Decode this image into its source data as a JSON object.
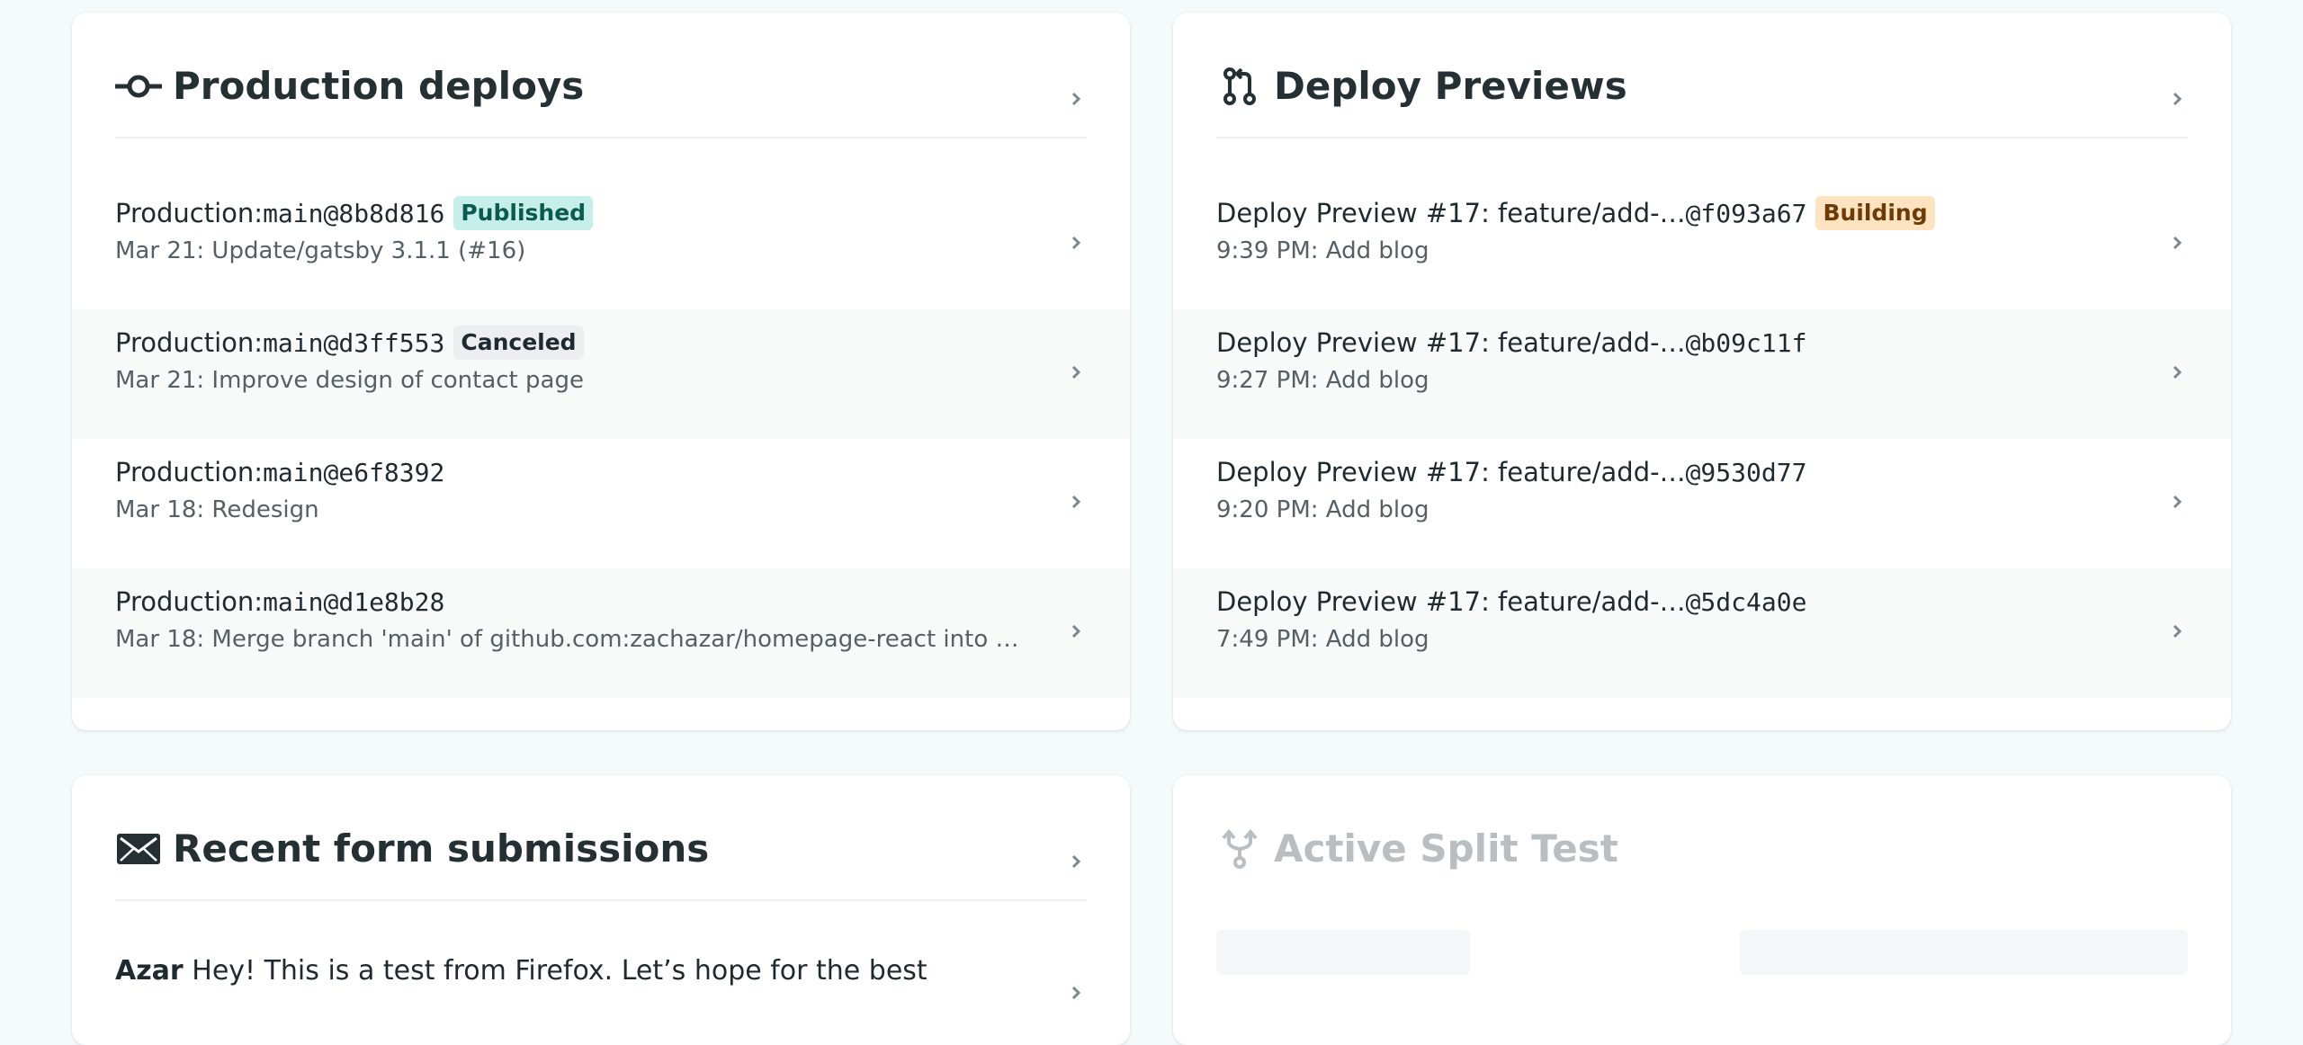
{
  "production": {
    "title": "Production deploys",
    "rows": [
      {
        "label": "Production: ",
        "ref": "main@8b8d816",
        "badge": "Published",
        "badge_type": "published",
        "sub": "Mar 21: Update/gatsby 3.1.1 (#16)"
      },
      {
        "label": "Production: ",
        "ref": "main@d3ff553",
        "badge": "Canceled",
        "badge_type": "canceled",
        "sub": "Mar 21: Improve design of contact page"
      },
      {
        "label": "Production: ",
        "ref": "main@e6f8392",
        "badge": "",
        "badge_type": "",
        "sub": "Mar 18: Redesign"
      },
      {
        "label": "Production: ",
        "ref": "main@d1e8b28",
        "badge": "",
        "badge_type": "",
        "sub": "Mar 18: Merge branch 'main' of github.com:zachazar/homepage-react into main"
      }
    ]
  },
  "previews": {
    "title": "Deploy Previews",
    "rows": [
      {
        "label": "Deploy Preview #17: feature/add-…",
        "ref": "@f093a67",
        "badge": "Building",
        "badge_type": "building",
        "sub": "9:39 PM: Add blog"
      },
      {
        "label": "Deploy Preview #17: feature/add-…",
        "ref": "@b09c11f",
        "badge": "",
        "badge_type": "",
        "sub": "9:27 PM: Add blog"
      },
      {
        "label": "Deploy Preview #17: feature/add-…",
        "ref": "@9530d77",
        "badge": "",
        "badge_type": "",
        "sub": "9:20 PM: Add blog"
      },
      {
        "label": "Deploy Preview #17: feature/add-…",
        "ref": "@5dc4a0e",
        "badge": "",
        "badge_type": "",
        "sub": "7:49 PM: Add blog"
      }
    ]
  },
  "forms": {
    "title": "Recent form submissions",
    "rows": [
      {
        "name": "Azar",
        "message": "Hey! This is a test from Firefox. Let’s hope for the best"
      }
    ]
  },
  "split_test": {
    "title": "Active Split Test"
  },
  "icons": {
    "production": "commit-icon",
    "previews": "pull-request-icon",
    "forms": "envelope-icon",
    "split_test": "split-arrows-icon",
    "chevron": "chevron-right-icon"
  },
  "colors": {
    "background": "#f5fafa",
    "published_bg": "#c7efe9",
    "building_bg": "#fde3bf",
    "canceled_bg": "#eceeef"
  }
}
